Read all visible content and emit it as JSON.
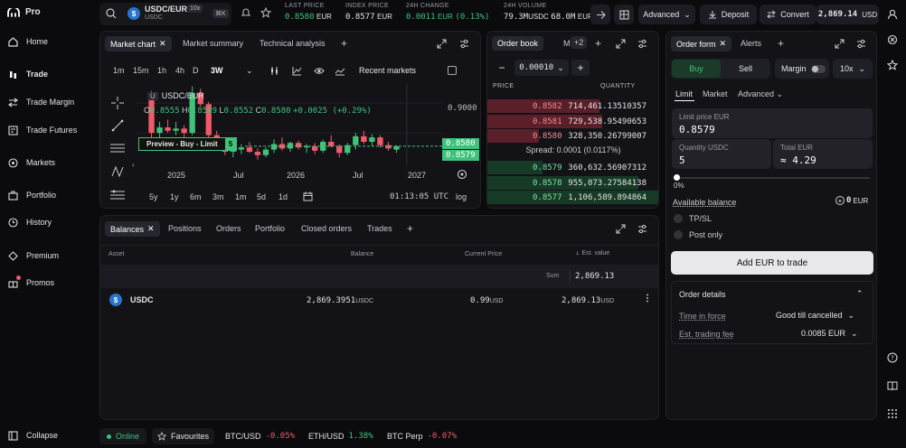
{
  "brand": {
    "name": "Pro"
  },
  "nav": {
    "items": [
      {
        "label": "Home",
        "icon": "home-icon"
      },
      {
        "label": "Trade",
        "icon": "trade-icon"
      },
      {
        "label": "Trade Margin",
        "icon": "margin-icon"
      },
      {
        "label": "Trade Futures",
        "icon": "futures-icon"
      },
      {
        "label": "Markets",
        "icon": "markets-icon"
      },
      {
        "label": "Portfolio",
        "icon": "portfolio-icon"
      },
      {
        "label": "History",
        "icon": "history-icon"
      },
      {
        "label": "Premium",
        "icon": "premium-icon"
      },
      {
        "label": "Promos",
        "icon": "promos-icon"
      }
    ],
    "collapse": "Collapse"
  },
  "topbar": {
    "pair": "USDC/EUR",
    "leverage": "10x",
    "sub": "USDC",
    "shortcut": "⌘K",
    "last_price_label": "LAST PRICE",
    "last_price": "0.8580",
    "last_price_unit": "EUR",
    "index_price_label": "INDEX PRICE",
    "index_price": "0.8577",
    "index_price_unit": "EUR",
    "change_label": "24H CHANGE",
    "change_value": "0.0011",
    "change_unit": "EUR",
    "change_pct": "(0.13%)",
    "volume_label": "24H VOLUME",
    "volume_value": "79.3M",
    "volume_unit": "USDC",
    "volume_value2": "68.0M",
    "volume_unit2": "EUR",
    "advanced": "Advanced",
    "deposit": "Deposit",
    "convert": "Convert",
    "balance": "2,869.14",
    "balance_unit": "USD"
  },
  "chart_panel": {
    "tabs": [
      "Market chart",
      "Market summary",
      "Technical analysis"
    ],
    "intervals": [
      "1m",
      "15m",
      "1h",
      "4h",
      "D",
      "3W"
    ],
    "recent_markets": "Recent markets",
    "legend_pair": "USDC/EUR",
    "ohlc": {
      "O": "0.8555",
      "H": "0.8589",
      "L": "0.8552",
      "C": "0.8580",
      "chg": "+0.0025 (+0.29%)"
    },
    "preview_label": "Preview - Buy - Limit",
    "preview_qty": "5",
    "price_axis_top": "0.9000",
    "price_tag_1": "0.8580",
    "price_tag_2": "0.8579",
    "x_labels": [
      "2025",
      "Jul",
      "2026",
      "Jul",
      "2027"
    ],
    "ranges": [
      "5y",
      "1y",
      "6m",
      "3m",
      "1m",
      "5d",
      "1d"
    ],
    "time": "01:13:05 UTC",
    "log": "log"
  },
  "chart_data": {
    "type": "candlestick",
    "pair": "USDC/EUR",
    "interval": "3W",
    "x_labels": [
      "2025",
      "Jul",
      "2026",
      "Jul",
      "2027"
    ],
    "y_ticks": [
      "0.9000"
    ],
    "candles": [
      {
        "o": 0.905,
        "h": 0.908,
        "l": 0.86,
        "c": 0.87
      },
      {
        "o": 0.87,
        "h": 0.88,
        "l": 0.866,
        "c": 0.875
      },
      {
        "o": 0.875,
        "h": 0.882,
        "l": 0.87,
        "c": 0.872
      },
      {
        "o": 0.872,
        "h": 0.88,
        "l": 0.868,
        "c": 0.874
      },
      {
        "o": 0.874,
        "h": 0.877,
        "l": 0.866,
        "c": 0.87
      },
      {
        "o": 0.87,
        "h": 0.912,
        "l": 0.868,
        "c": 0.906
      },
      {
        "o": 0.906,
        "h": 0.91,
        "l": 0.894,
        "c": 0.896
      },
      {
        "o": 0.896,
        "h": 0.898,
        "l": 0.866,
        "c": 0.868
      },
      {
        "o": 0.868,
        "h": 0.872,
        "l": 0.855,
        "c": 0.858
      },
      {
        "o": 0.858,
        "h": 0.862,
        "l": 0.85,
        "c": 0.853
      },
      {
        "o": 0.853,
        "h": 0.858,
        "l": 0.848,
        "c": 0.855
      },
      {
        "o": 0.855,
        "h": 0.86,
        "l": 0.851,
        "c": 0.857
      },
      {
        "o": 0.857,
        "h": 0.862,
        "l": 0.852,
        "c": 0.853
      },
      {
        "o": 0.853,
        "h": 0.856,
        "l": 0.846,
        "c": 0.85
      },
      {
        "o": 0.85,
        "h": 0.857,
        "l": 0.848,
        "c": 0.855
      },
      {
        "o": 0.855,
        "h": 0.864,
        "l": 0.852,
        "c": 0.86
      },
      {
        "o": 0.86,
        "h": 0.866,
        "l": 0.854,
        "c": 0.856
      },
      {
        "o": 0.856,
        "h": 0.862,
        "l": 0.853,
        "c": 0.861
      },
      {
        "o": 0.861,
        "h": 0.863,
        "l": 0.855,
        "c": 0.857
      },
      {
        "o": 0.857,
        "h": 0.86,
        "l": 0.852,
        "c": 0.858
      },
      {
        "o": 0.858,
        "h": 0.861,
        "l": 0.851,
        "c": 0.854
      },
      {
        "o": 0.854,
        "h": 0.864,
        "l": 0.852,
        "c": 0.862
      },
      {
        "o": 0.862,
        "h": 0.868,
        "l": 0.857,
        "c": 0.858
      },
      {
        "o": 0.858,
        "h": 0.86,
        "l": 0.848,
        "c": 0.852
      },
      {
        "o": 0.852,
        "h": 0.861,
        "l": 0.85,
        "c": 0.859
      },
      {
        "o": 0.859,
        "h": 0.87,
        "l": 0.855,
        "c": 0.867
      },
      {
        "o": 0.867,
        "h": 0.872,
        "l": 0.86,
        "c": 0.862
      },
      {
        "o": 0.862,
        "h": 0.869,
        "l": 0.858,
        "c": 0.866
      },
      {
        "o": 0.866,
        "h": 0.868,
        "l": 0.857,
        "c": 0.859
      },
      {
        "o": 0.859,
        "h": 0.862,
        "l": 0.854,
        "c": 0.856
      },
      {
        "o": 0.855,
        "h": 0.859,
        "l": 0.852,
        "c": 0.858
      }
    ]
  },
  "orderbook": {
    "tabs": [
      "Order book",
      "M"
    ],
    "more": "+2",
    "tick": "0.00010",
    "col_price": "PRICE",
    "col_qty": "QUANTITY",
    "asks": [
      {
        "price": "0.8582",
        "qty": "714,461.13510357",
        "depth": 0.65
      },
      {
        "price": "0.8581",
        "qty": "729,538.95490653",
        "depth": 0.67
      },
      {
        "price": "0.8580",
        "qty": "328,350.26799007",
        "depth": 0.3
      }
    ],
    "spread": "Spread: 0.0001 (0.0117%)",
    "bids": [
      {
        "price": "0.8579",
        "qty": "360,632.56907312",
        "depth": 0.32
      },
      {
        "price": "0.8578",
        "qty": "955,073.27584138",
        "depth": 0.88
      },
      {
        "price": "0.8577",
        "qty": "1,106,589.894864",
        "depth": 1.0
      }
    ]
  },
  "orderform": {
    "tabs": [
      "Order form",
      "Alerts"
    ],
    "buy": "Buy",
    "sell": "Sell",
    "margin": "Margin",
    "leverage": "10x",
    "types": [
      "Limit",
      "Market",
      "Advanced"
    ],
    "limit_price_label": "Limit price EUR",
    "limit_price": "0.8579",
    "qty_label": "Quantity USDC",
    "qty": "5",
    "total_label": "Total EUR",
    "total": "4.29",
    "slider_pct": "0%",
    "avail_label": "Available balance",
    "avail_value": "0",
    "avail_unit": "EUR",
    "tpsl": "TP/SL",
    "postonly": "Post only",
    "add_btn": "Add EUR to trade",
    "details_title": "Order details",
    "tif_label": "Time in force",
    "tif_value": "Good till cancelled",
    "fee_label": "Est. trading fee",
    "fee_value": "0.0085 EUR"
  },
  "balances": {
    "tabs": [
      "Balances",
      "Positions",
      "Orders",
      "Portfolio",
      "Closed orders",
      "Trades"
    ],
    "cols": [
      "Asset",
      "Balance",
      "Current Price",
      "Est. value"
    ],
    "sum_label": "Sum",
    "sum_value": "2,869.13",
    "rows": [
      {
        "asset": "USDC",
        "balance": "2,869.3951",
        "balance_unit": "USDC",
        "price": "0.99",
        "price_unit": "USD",
        "value": "2,869.13",
        "value_unit": "USD"
      }
    ]
  },
  "bottombar": {
    "online": "Online",
    "favourites": "Favourites",
    "tickers": [
      {
        "name": "BTC/USD",
        "chg": "-0.05%",
        "color": "#f05a6a"
      },
      {
        "name": "ETH/USD",
        "chg": "1.38%",
        "color": "#3fc27a"
      },
      {
        "name": "BTC Perp",
        "chg": "-0.07%",
        "color": "#f05a6a"
      }
    ]
  },
  "colors": {
    "green": "#3fc27a",
    "red": "#f05a6a",
    "panel": "#131317",
    "accent": "#7b5cff"
  }
}
